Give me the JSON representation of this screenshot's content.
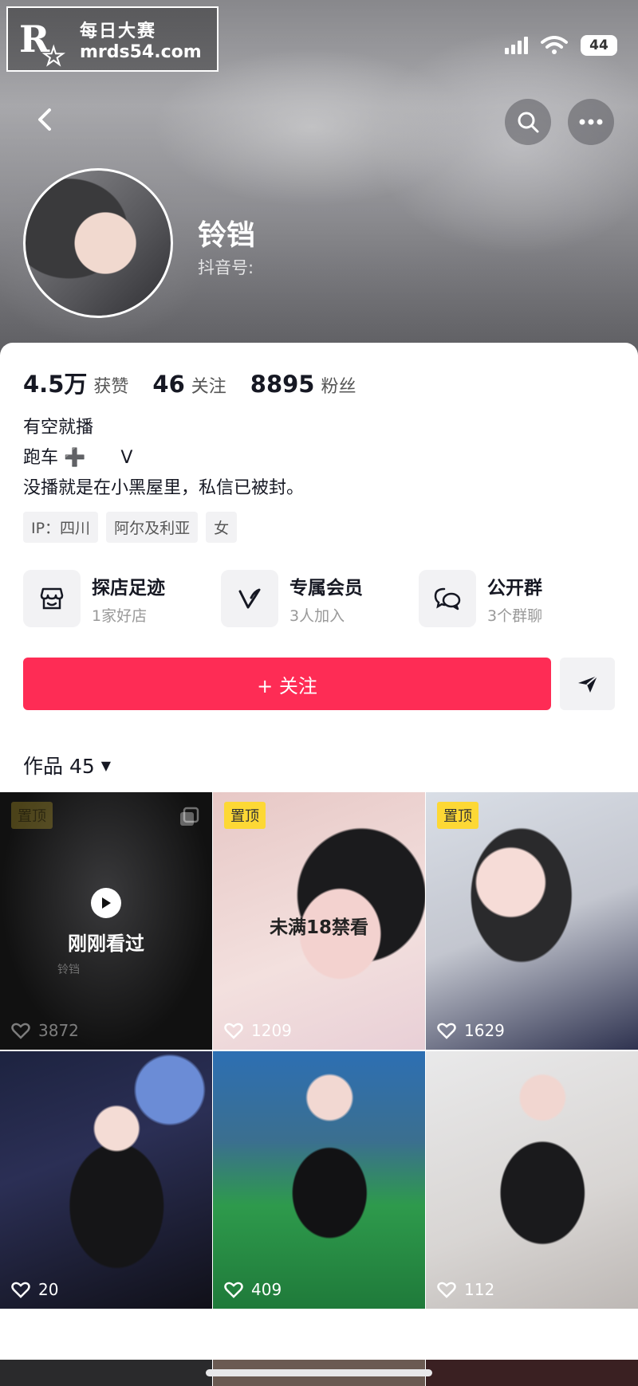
{
  "watermark": {
    "logo_letter": "R",
    "line1": "每日大赛",
    "line2": "mrds54.com"
  },
  "status_bar": {
    "battery": "44"
  },
  "profile": {
    "nickname": "铃铛",
    "douyin_id_label": "抖音号:",
    "stats": [
      {
        "value": "4.5万",
        "label": "获赞"
      },
      {
        "value": "46",
        "label": "关注"
      },
      {
        "value": "8895",
        "label": "粉丝"
      }
    ],
    "bio_lines": [
      "有空就播",
      "跑车 ➕　　V",
      "没播就是在小黑屋里，私信已被封。"
    ],
    "tags": [
      "IP：四川",
      "阿尔及利亚",
      "女"
    ]
  },
  "entries": [
    {
      "title": "探店足迹",
      "sub": "1家好店",
      "icon": "shop-icon"
    },
    {
      "title": "专属会员",
      "sub": "3人加入",
      "icon": "member-v-icon"
    },
    {
      "title": "公开群",
      "sub": "3个群聊",
      "icon": "group-chat-icon"
    }
  ],
  "follow_button": {
    "label": "+ 关注"
  },
  "works_tab": {
    "label": "作品 45",
    "caret": "▼"
  },
  "videos": [
    {
      "pinned": "置顶",
      "likes": "3872",
      "overlay_play": true,
      "overlay_text": "刚刚看过",
      "overlay_author": "铃铛",
      "multi": true
    },
    {
      "pinned": "置顶",
      "likes": "1209",
      "overlay_text": "未满18禁看"
    },
    {
      "pinned": "置顶",
      "likes": "1629"
    },
    {
      "likes": "20"
    },
    {
      "likes": "409"
    },
    {
      "likes": "112"
    }
  ],
  "colors": {
    "accent": "#fe2c55",
    "pin": "#fdd835"
  }
}
